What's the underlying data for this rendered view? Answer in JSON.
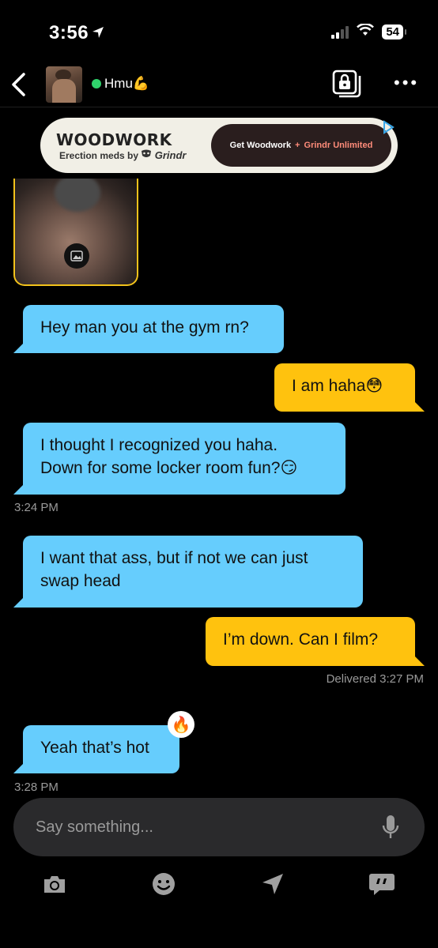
{
  "status_bar": {
    "time": "3:56",
    "battery": "54"
  },
  "header": {
    "username": "Hmu",
    "username_emoji": "💪",
    "online_color": "#2fd36b"
  },
  "ad": {
    "brand": "WOODWORK",
    "tagline": "Erection meds by",
    "tagline_brand": "Grindr",
    "cta_part1": "Get Woodwork",
    "cta_plus": "+",
    "cta_part2": "Grindr Unlimited"
  },
  "messages": [
    {
      "direction": "in",
      "text": "Hey man you at the gym rn?"
    },
    {
      "direction": "out",
      "text": "I am haha",
      "emoji": "😳"
    },
    {
      "direction": "in",
      "text_line1": "I thought I recognized you haha.",
      "text_line2": "Down for some locker room fun?",
      "emoji": "😏"
    },
    {
      "direction": "in",
      "text_line1": "I want that ass, but if not we can just",
      "text_line2": "swap head"
    },
    {
      "direction": "out",
      "text": "I’m down. Can I film?"
    },
    {
      "direction": "in",
      "text": "Yeah that’s hot",
      "reaction": "🔥"
    }
  ],
  "timestamps": {
    "t1": "3:24 PM",
    "delivered_label": "Delivered",
    "delivered_time": "3:27 PM",
    "t2": "3:28 PM"
  },
  "input": {
    "placeholder": "Say something..."
  },
  "toolbar": {
    "icons": [
      "camera-icon",
      "emoji-icon",
      "location-icon",
      "saved-phrases-icon"
    ]
  },
  "colors": {
    "incoming": "#66cdfd",
    "outgoing": "#ffc20e",
    "background": "#000000"
  }
}
